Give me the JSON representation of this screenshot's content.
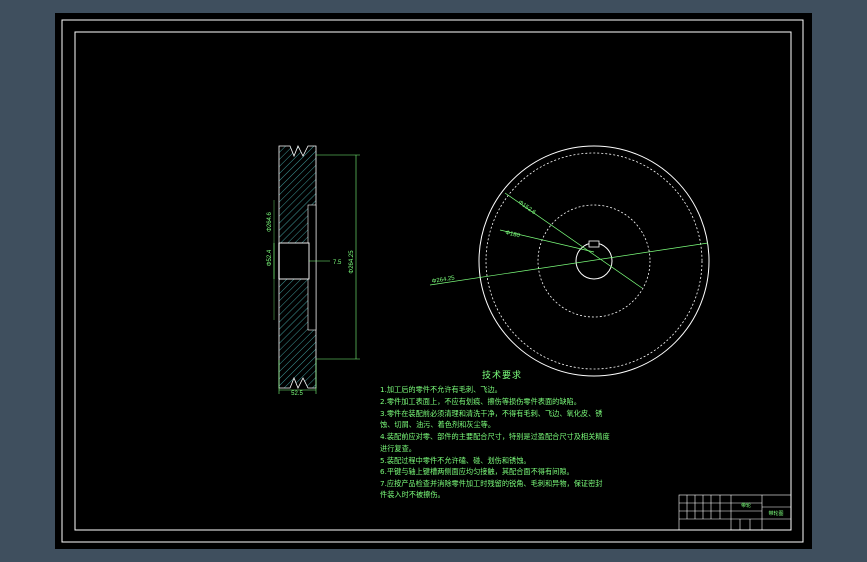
{
  "drawing": {
    "dimensions": {
      "width": "52.5",
      "keyway": "7.5",
      "dia_outer_left": "Φ264.25",
      "dia_inner_left": "Φ52.4",
      "dia_bore_left": "Φ264.6",
      "dia_circle1": "Φ152.6",
      "dia_circle2": "Φ180",
      "dia_circle3": "Φ264.25"
    },
    "notes": {
      "title": "技术要求",
      "lines": [
        "1.加工后的零件不允许有毛刺、飞边。",
        "2.零件加工表面上，不应有划痕、擦伤等损伤零件表面的缺陷。",
        "3.零件在装配前必须清理和清洗干净，不得有毛刺、飞边、氧化皮、锈",
        "蚀、切屑、油污、着色剂和灰尘等。",
        "4.装配前应对零、部件的主要配合尺寸，特别是过盈配合尺寸及相关精度",
        "进行复查。",
        "5.装配过程中零件不允许磕、碰、划伤和锈蚀。",
        "6.平键与轴上键槽两侧面应均匀接触，其配合面不得有间隙。",
        "7.应按产品检查并消除零件加工时残留的锐角、毛刺和异物，保证密封",
        "件装入时不被擦伤。"
      ]
    },
    "title_block": {
      "part_name": "带轮",
      "drawing_no": "带轮图"
    }
  },
  "colors": {
    "viewport_bg": "#000000",
    "app_bg": "#3f4f5e",
    "frame": "#ffffff",
    "annotation": "#7cff7c",
    "hatch": "#4fc0c0"
  }
}
